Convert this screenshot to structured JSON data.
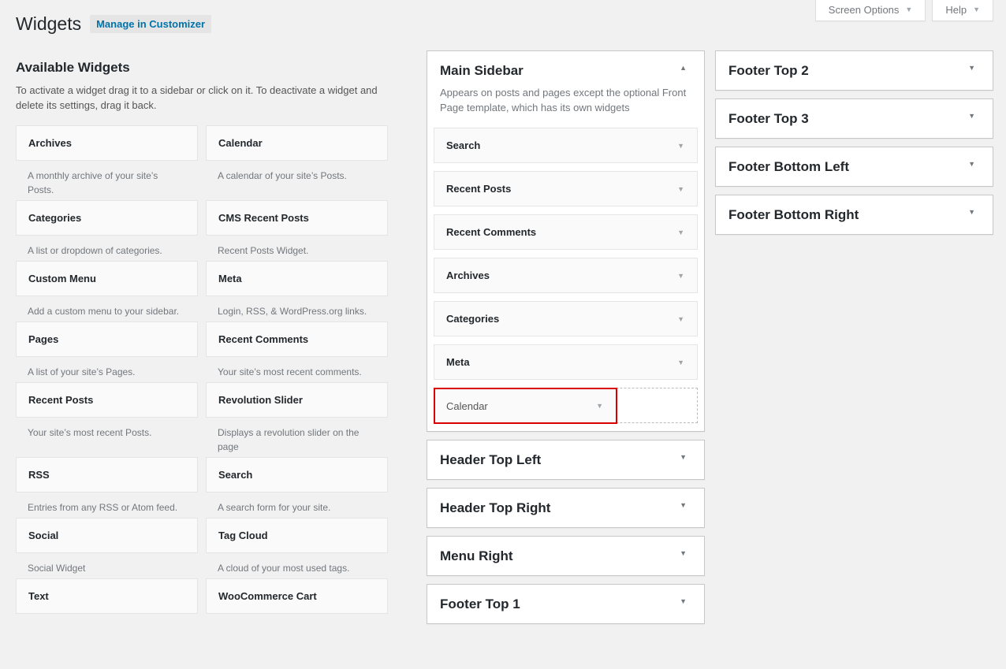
{
  "screen_meta": {
    "screen_options": "Screen Options",
    "help": "Help"
  },
  "header": {
    "title": "Widgets",
    "customizer_button": "Manage in Customizer"
  },
  "available": {
    "title": "Available Widgets",
    "description": "To activate a widget drag it to a sidebar or click on it. To deactivate a widget and delete its settings, drag it back.",
    "widgets": [
      {
        "name": "Archives",
        "desc": "A monthly archive of your site’s Posts."
      },
      {
        "name": "Calendar",
        "desc": "A calendar of your site’s Posts."
      },
      {
        "name": "Categories",
        "desc": "A list or dropdown of categories."
      },
      {
        "name": "CMS Recent Posts",
        "desc": "Recent Posts Widget."
      },
      {
        "name": "Custom Menu",
        "desc": "Add a custom menu to your sidebar."
      },
      {
        "name": "Meta",
        "desc": "Login, RSS, & WordPress.org links."
      },
      {
        "name": "Pages",
        "desc": "A list of your site’s Pages."
      },
      {
        "name": "Recent Comments",
        "desc": "Your site’s most recent comments."
      },
      {
        "name": "Recent Posts",
        "desc": "Your site’s most recent Posts."
      },
      {
        "name": "Revolution Slider",
        "desc": "Displays a revolution slider on the page"
      },
      {
        "name": "RSS",
        "desc": "Entries from any RSS or Atom feed."
      },
      {
        "name": "Search",
        "desc": "A search form for your site."
      },
      {
        "name": "Social",
        "desc": "Social Widget"
      },
      {
        "name": "Tag Cloud",
        "desc": "A cloud of your most used tags."
      },
      {
        "name": "Text",
        "desc": ""
      },
      {
        "name": "WooCommerce Cart",
        "desc": ""
      }
    ]
  },
  "main_sidebar": {
    "title": "Main Sidebar",
    "description": "Appears on posts and pages except the optional Front Page template, which has its own widgets",
    "widgets": [
      "Search",
      "Recent Posts",
      "Recent Comments",
      "Archives",
      "Categories",
      "Meta"
    ],
    "dragging_widget": "Calendar"
  },
  "middle_sidebars": [
    "Header Top Left",
    "Header Top Right",
    "Menu Right",
    "Footer Top 1"
  ],
  "right_sidebars": [
    "Footer Top 2",
    "Footer Top 3",
    "Footer Bottom Left",
    "Footer Bottom Right"
  ],
  "colors": {
    "accent": "#0073aa",
    "highlight": "#d90000",
    "background": "#f1f1f1"
  }
}
